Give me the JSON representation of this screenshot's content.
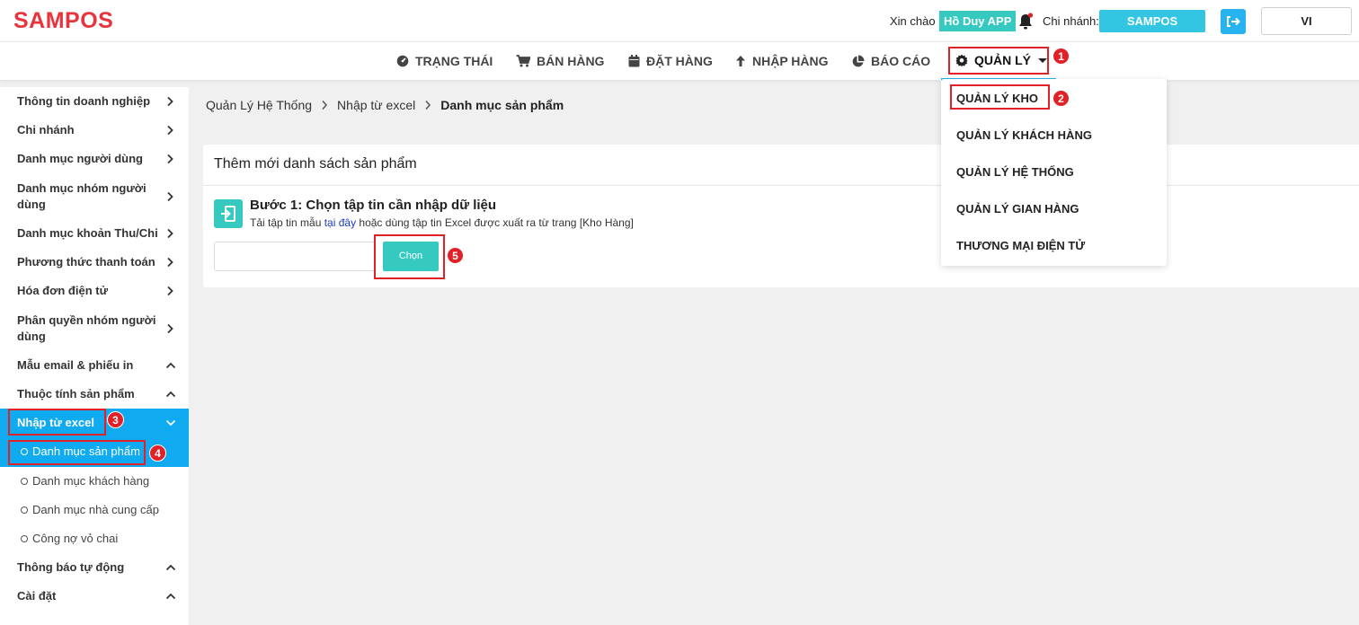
{
  "header": {
    "logo": "SAMPOS",
    "greeting": "Xin chào",
    "user_name": "Hồ Duy APP",
    "branch_label": "Chi nhánh:",
    "branch_name": "SAMPOS",
    "language": "VI"
  },
  "nav": {
    "items": [
      {
        "label": "TRẠNG THÁI",
        "icon": "dashboard-icon"
      },
      {
        "label": "BÁN HÀNG",
        "icon": "cart-icon"
      },
      {
        "label": "ĐẶT HÀNG",
        "icon": "calendar-icon"
      },
      {
        "label": "NHẬP HÀNG",
        "icon": "arrow-up-icon"
      },
      {
        "label": "BÁO CÁO",
        "icon": "pie-chart-icon"
      },
      {
        "label": "QUẢN LÝ",
        "icon": "gear-icon"
      }
    ]
  },
  "dropdown": {
    "items": [
      "QUẢN LÝ KHO",
      "QUẢN LÝ KHÁCH HÀNG",
      "QUẢN LÝ HỆ THỐNG",
      "QUẢN LÝ GIAN HÀNG",
      "THƯƠNG MẠI ĐIỆN TỬ"
    ]
  },
  "markers": [
    "1",
    "2",
    "3",
    "4",
    "5"
  ],
  "sidebar": {
    "items": [
      {
        "label": "Thông tin doanh nghiệp"
      },
      {
        "label": "Chi nhánh"
      },
      {
        "label": "Danh mục người dùng"
      },
      {
        "label": "Danh mục nhóm người dùng"
      },
      {
        "label": "Danh mục khoản Thu/Chi"
      },
      {
        "label": "Phương thức thanh toán"
      },
      {
        "label": "Hóa đơn điện tử"
      },
      {
        "label": "Phân quyền nhóm người dùng"
      },
      {
        "label": "Mẫu email & phiếu in"
      },
      {
        "label": "Thuộc tính sản phẩm"
      },
      {
        "label": "Nhập từ excel"
      },
      {
        "label": "Thông báo tự động"
      },
      {
        "label": "Cài đặt"
      }
    ],
    "sub_items": [
      "Danh mục sản phẩm",
      "Danh mục khách hàng",
      "Danh mục nhà cung cấp",
      "Công nợ vỏ chai"
    ]
  },
  "breadcrumb": [
    "Quản Lý Hệ Thống",
    "Nhập từ excel",
    "Danh mục sản phẩm"
  ],
  "card": {
    "title": "Thêm mới danh sách sản phẩm",
    "step_title": "Bước 1: Chọn tập tin cần nhập dữ liệu",
    "desc_before": "Tải tập tin mẫu ",
    "desc_link": "tại đây",
    "desc_after": " hoặc dùng tập tin Excel được xuất ra từ trang [Kho Hàng]",
    "choose_button": "Chọn",
    "file_value": ""
  },
  "colors": {
    "brand_red": "#e8343c",
    "accent_blue": "#0faaf0",
    "teal": "#36c9c0",
    "highlight_red": "#e02127"
  }
}
